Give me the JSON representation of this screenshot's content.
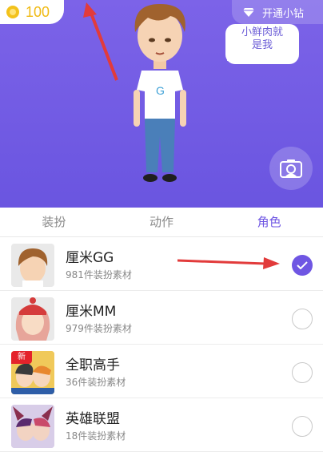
{
  "header": {
    "coins": "100",
    "vip_label": "开通小钻",
    "bubble_line1": "小鲜肉就",
    "bubble_line2": "是我"
  },
  "tabs": [
    {
      "label": "装扮",
      "active": false
    },
    {
      "label": "动作",
      "active": false
    },
    {
      "label": "角色",
      "active": true
    }
  ],
  "characters": [
    {
      "name": "厘米GG",
      "count": "981件装扮素材",
      "selected": true
    },
    {
      "name": "厘米MM",
      "count": "979件装扮素材",
      "selected": false
    },
    {
      "name": "全职高手",
      "count": "36件装扮素材",
      "selected": false,
      "badge": "新"
    },
    {
      "name": "英雄联盟",
      "count": "18件装扮素材",
      "selected": false
    }
  ],
  "colors": {
    "accent": "#6f56e3",
    "hero_bg": "#7c63e8",
    "coin": "#f0ba14",
    "arrow": "#e23b3b"
  }
}
